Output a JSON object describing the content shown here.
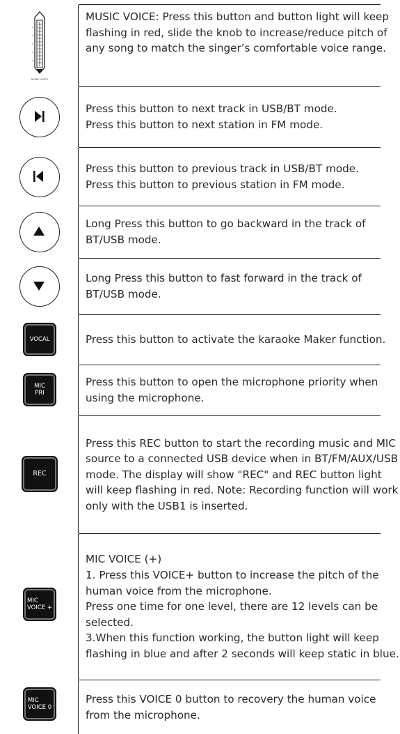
{
  "rows": [
    {
      "icon": "music-voice-slider-icon",
      "icon_caption": "MUSIC VOICE",
      "text": "MUSIC VOICE: Press this button and button light will keep flashing in red,  slide the knob to increase/reduce pitch of any song to match the singer’s comfortable voice range."
    },
    {
      "icon": "next-track-icon",
      "text": "Press this button to next track in USB/BT mode.\nPress this button to next station in FM mode."
    },
    {
      "icon": "previous-track-icon",
      "text": "Press this button to previous track in USB/BT mode.\nPress this button to previous station in FM mode."
    },
    {
      "icon": "up-arrow-icon",
      "text": "Long Press this button to go backward in the track of BT/USB mode."
    },
    {
      "icon": "down-arrow-icon",
      "text": "Long Press this button to fast forward in the track of BT/USB mode."
    },
    {
      "icon": "vocal-button-icon",
      "button_label": "VOCAL",
      "text": "Press this button to activate the karaoke Maker function."
    },
    {
      "icon": "mic-pri-button-icon",
      "button_label": "MIC\nPRI",
      "text": "Press this button to open the microphone priority when using the  microphone."
    },
    {
      "icon": "rec-button-icon",
      "button_label": "REC",
      "text": "Press this REC button to start the recording music and MIC source to a  connected USB device when in BT/FM/AUX/USB mode. The display will show \"REC\" and REC button light will keep flashing in red. Note: Recording function will work only with the USB1 is inserted."
    },
    {
      "icon": "mic-voice-plus-button-icon",
      "button_label": "MIC\nVOICE +",
      "text": "MIC VOICE (+)\n1. Press this VOICE+ button to increase the pitch of the human voice from the microphone.\nPress one time for one level, there are 12 levels can be selected.\n3.When this function working, the button light will keep flashing in blue and after 2 seconds will keep static in blue."
    },
    {
      "icon": "mic-voice-zero-button-icon",
      "button_label": "MIC\nVOICE 0",
      "text": "Press this VOICE 0 button to recovery the human voice from the microphone."
    }
  ]
}
